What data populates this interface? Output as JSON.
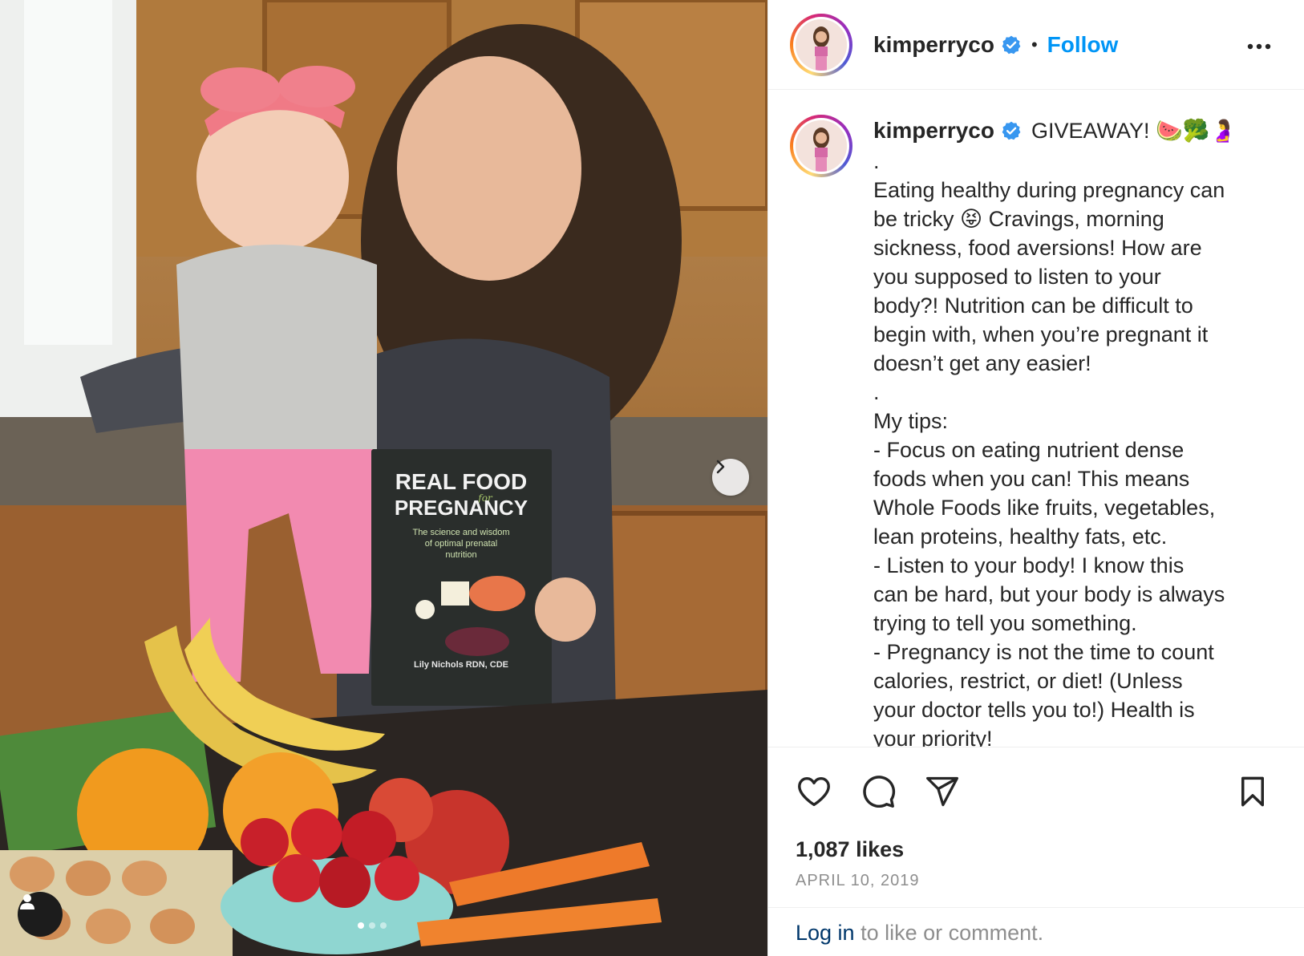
{
  "post": {
    "username": "kimperryco",
    "verified": true,
    "separator": "•",
    "follow_label": "Follow",
    "more_icon": "more-horizontal-icon"
  },
  "photo": {
    "book_title_line1": "REAL FOOD",
    "book_title_for": "for",
    "book_title_line2": "PREGNANCY",
    "book_subtitle_1": "The science and wisdom",
    "book_subtitle_2": "of optimal prenatal",
    "book_subtitle_3": "nutrition",
    "book_author": "Lily Nichols RDN, CDE",
    "carousel_total": 3,
    "carousel_active": 1
  },
  "caption": {
    "username": "kimperryco",
    "title": "GIVEAWAY! 🍉🥦🤰",
    "lines": [
      ".",
      "Eating healthy during pregnancy can",
      "be tricky 😝 Cravings, morning",
      "sickness, food aversions! How are",
      "you supposed to listen to your",
      "body?! Nutrition can be difficult to",
      "begin with, when you’re pregnant it",
      "doesn’t get any easier!",
      ".",
      "My tips:",
      "- Focus on eating nutrient dense",
      "foods when you can! This means",
      "Whole Foods like fruits, vegetables,",
      "lean proteins, healthy fats, etc.",
      "- Listen to your body! I know this",
      "can be hard, but your body is always",
      "trying to tell you something.",
      "- Pregnancy is not the time to count",
      "calories, restrict, or diet! (Unless",
      "your doctor tells you to!) Health is",
      "your priority!"
    ]
  },
  "actions": {
    "like_icon": "heart-icon",
    "comment_icon": "comment-icon",
    "share_icon": "share-icon",
    "save_icon": "bookmark-icon",
    "likes": "1,087 likes",
    "date": "APRIL 10, 2019"
  },
  "login": {
    "link": "Log in",
    "rest": " to like or comment."
  },
  "colors": {
    "accent": "#0095f6",
    "verified": "#3897f0",
    "text": "#262626",
    "muted": "#8e8e8e",
    "login_link": "#00376b"
  }
}
